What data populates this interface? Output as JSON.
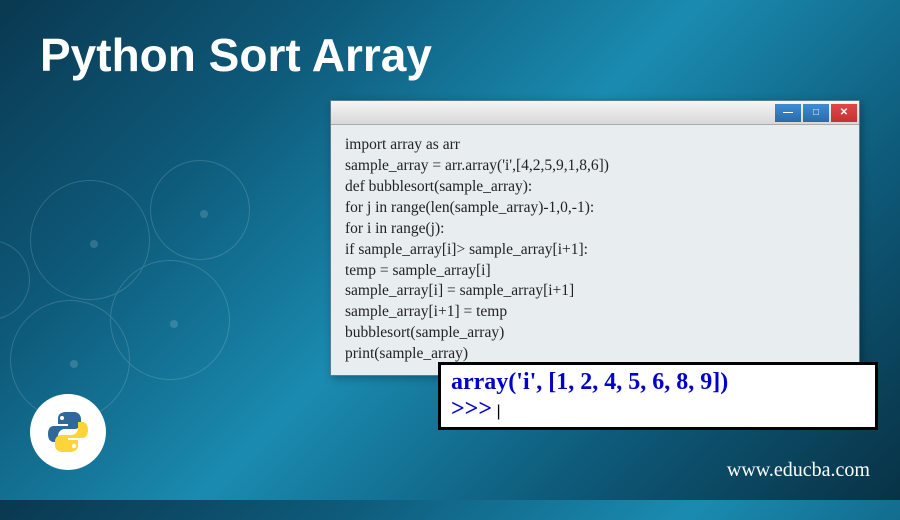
{
  "title": "Python Sort Array",
  "code": {
    "lines": [
      "import array as arr",
      "sample_array = arr.array('i',[4,2,5,9,1,8,6])",
      "def bubblesort(sample_array):",
      "for j in range(len(sample_array)-1,0,-1):",
      "for i in range(j):",
      "if sample_array[i]> sample_array[i+1]:",
      "temp = sample_array[i]",
      "sample_array[i] = sample_array[i+1]",
      "sample_array[i+1] = temp",
      "bubblesort(sample_array)",
      "print(sample_array)"
    ]
  },
  "output": {
    "result": "array('i', [1, 2, 4, 5, 6, 8, 9])",
    "prompt": ">>>",
    "cursor": "|"
  },
  "window_controls": {
    "min": "—",
    "max": "□",
    "close": "✕"
  },
  "website": "www.educba.com"
}
